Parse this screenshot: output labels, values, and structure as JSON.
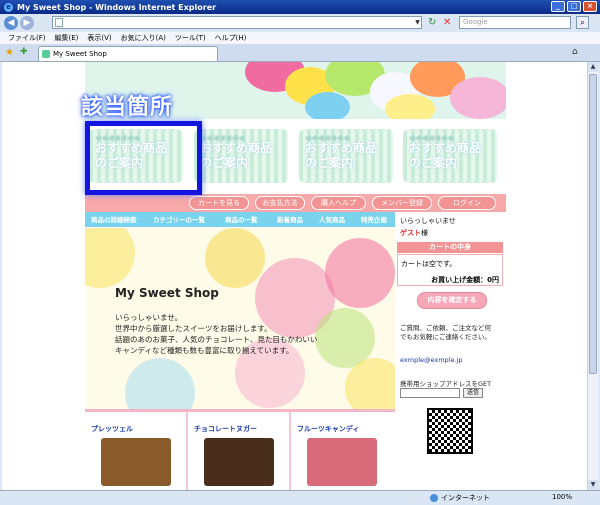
{
  "window": {
    "title": "My Sweet Shop - Windows Internet Explorer",
    "minimize": "_",
    "maximize": "□",
    "close": "×"
  },
  "toolbar": {
    "back": "◀",
    "forward": "▶",
    "address_value": "",
    "search_placeholder": "Google",
    "refresh": "↻",
    "stop": "✕",
    "search_button": "⌕"
  },
  "menu": [
    "ファイル(F)",
    "編集(E)",
    "表示(V)",
    "お気に入り(A)",
    "ツール(T)",
    "ヘルプ(H)"
  ],
  "tab": {
    "title": "My Sweet Shop"
  },
  "status": {
    "zone": "インターネット",
    "zoom": "100%"
  },
  "annotation": {
    "label": "該当箇所"
  },
  "banners": [
    {
      "line1": "おすすめ商品",
      "line2": "のご案内"
    },
    {
      "line1": "おすすめ商品",
      "line2": "のご案内"
    },
    {
      "line1": "おすすめ商品",
      "line2": "のご案内"
    },
    {
      "line1": "おすすめ商品",
      "line2": "のご案内"
    }
  ],
  "nav_primary": [
    "カートを見る",
    "お支払方法",
    "購入ヘルプ",
    "メンバー登録",
    "ログイン"
  ],
  "nav_secondary": [
    "商品の詳細検索",
    "カテゴリーの一覧",
    "商品の一覧",
    "新着商品",
    "人気商品",
    "特売企画"
  ],
  "hero": {
    "title": "My Sweet Shop",
    "lines": [
      "いらっしゃいませ。",
      "世界中から厳選したスイーツをお届けします。",
      "話題のあのお菓子、人気のチョコレート、見た目もかわいい",
      "キャンディなど種類も数も豊富に取り揃えています。"
    ]
  },
  "products": [
    {
      "name": "プレッツェル",
      "color": "#8a5a2a"
    },
    {
      "name": "チョコレートヌガー",
      "color": "#4a2e1c"
    },
    {
      "name": "フルーツキャンディ",
      "color": "#d86a7a"
    }
  ],
  "sidebar": {
    "welcome": "いらっしゃいませ",
    "guest_name": "ゲスト",
    "guest_suffix": "様",
    "cart_header": "カートの中身",
    "cart_empty": "カートは空です。",
    "cart_total": "お買い上げ金額：0円",
    "confirm_button": "内容を確定する",
    "contact_lines": [
      "ご質問、ご依頼、ご注文など何",
      "でもお気軽にご連絡ください。"
    ],
    "email": "exmple@exmple.jp",
    "mobile_label": "携帯用ショップアドレスをGET",
    "mobile_button": "送信"
  },
  "colors": {
    "nav_primary_bg": "#f7a8a8",
    "nav_secondary_bg": "#7ad3ec",
    "highlight": "#1515e0",
    "cart_header_bg": "#f29494"
  }
}
